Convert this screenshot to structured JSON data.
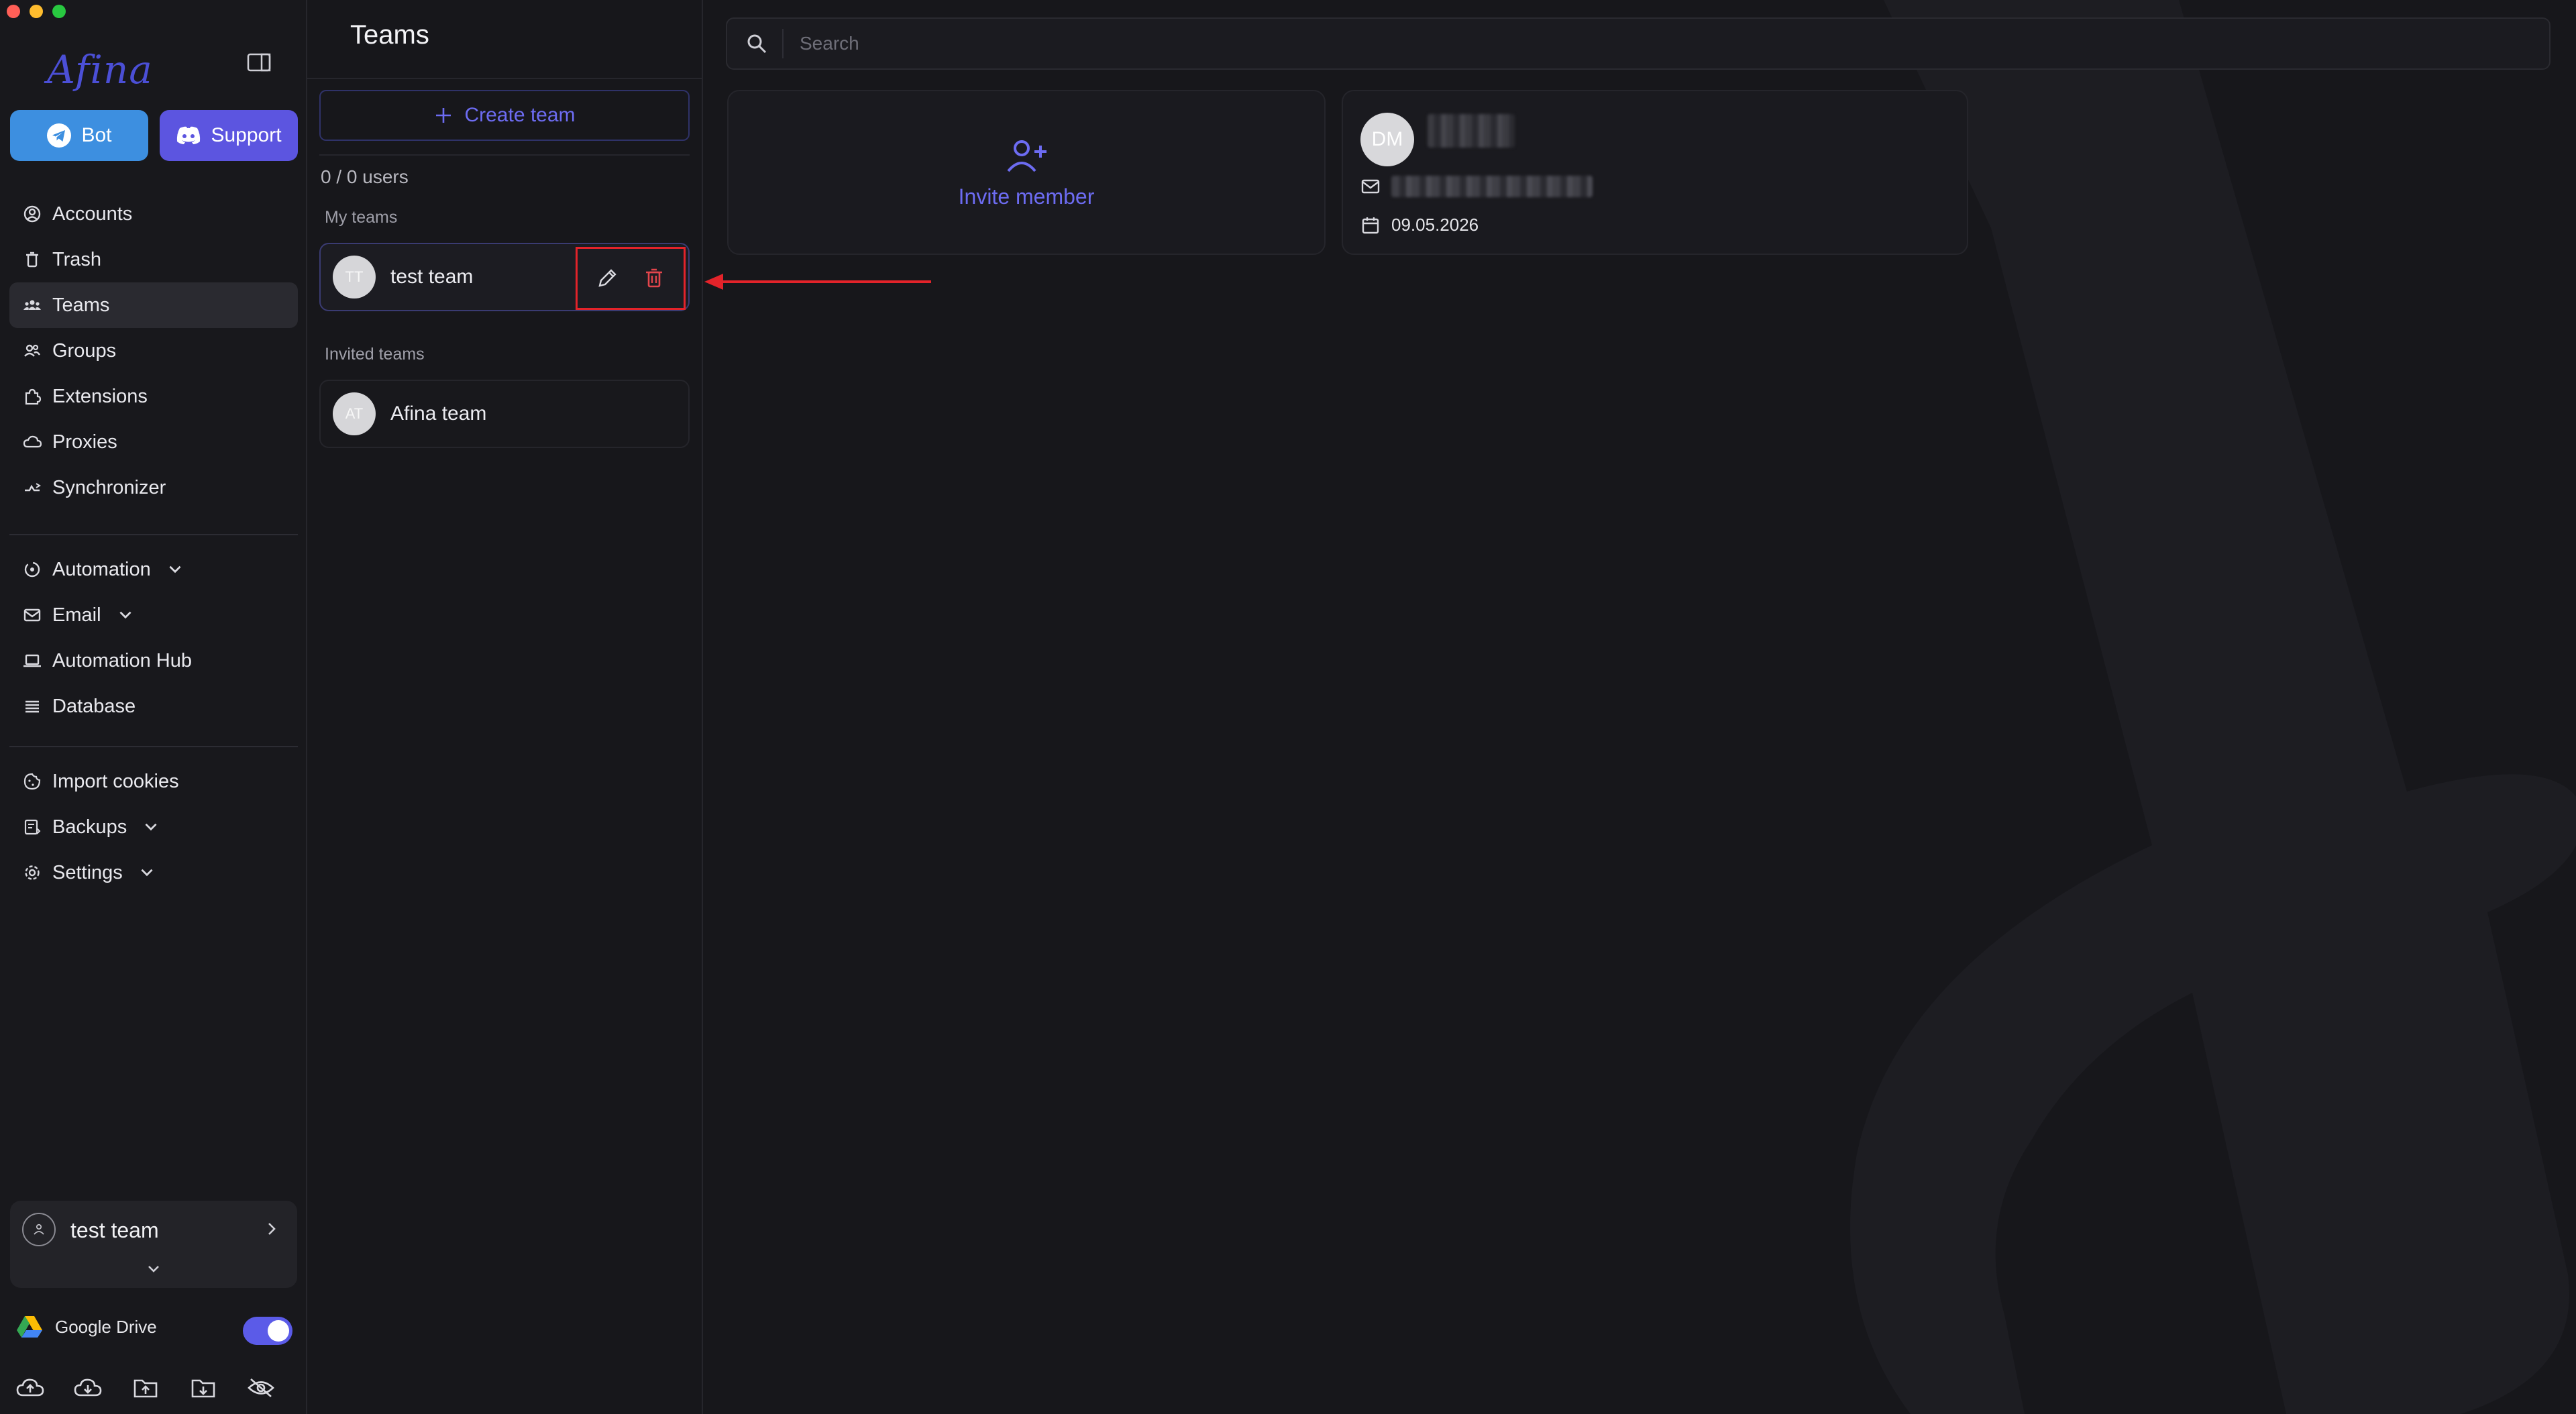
{
  "sidebar": {
    "logo_text": "Afina",
    "bot_label": "Bot",
    "support_label": "Support",
    "nav": [
      {
        "label": "Accounts",
        "icon": "user-circle-icon"
      },
      {
        "label": "Trash",
        "icon": "trash-icon"
      },
      {
        "label": "Teams",
        "icon": "team-icon",
        "active": true
      },
      {
        "label": "Groups",
        "icon": "groups-icon"
      },
      {
        "label": "Extensions",
        "icon": "puzzle-icon"
      },
      {
        "label": "Proxies",
        "icon": "cloud-icon"
      },
      {
        "label": "Synchronizer",
        "icon": "sync-icon"
      }
    ],
    "nav2": [
      {
        "label": "Automation",
        "icon": "automation-icon",
        "expandable": true
      },
      {
        "label": "Email",
        "icon": "mail-icon",
        "expandable": true
      },
      {
        "label": "Automation Hub",
        "icon": "laptop-icon"
      },
      {
        "label": "Database",
        "icon": "list-icon"
      }
    ],
    "nav3": [
      {
        "label": "Import cookies",
        "icon": "cookie-icon"
      },
      {
        "label": "Backups",
        "icon": "backup-icon",
        "expandable": true
      },
      {
        "label": "Settings",
        "icon": "gear-icon",
        "expandable": true
      }
    ],
    "team_switcher": {
      "name": "test team"
    },
    "google_drive": {
      "label": "Google Drive",
      "enabled": true
    }
  },
  "teams": {
    "title": "Teams",
    "create_label": "Create team",
    "users_count": "0 / 0 users",
    "my_teams_label": "My teams",
    "invited_teams_label": "Invited teams",
    "my_teams": [
      {
        "initials": "TT",
        "name": "test team"
      }
    ],
    "invited_teams": [
      {
        "initials": "AT",
        "name": "Afina team"
      }
    ]
  },
  "main": {
    "search_placeholder": "Search",
    "invite_label": "Invite member",
    "member": {
      "initials": "DM",
      "date": "09.05.2026"
    }
  },
  "colors": {
    "accent": "#5c55e0",
    "bot": "#3d8fe0",
    "danger": "#e3232a",
    "background": "#17171b"
  }
}
